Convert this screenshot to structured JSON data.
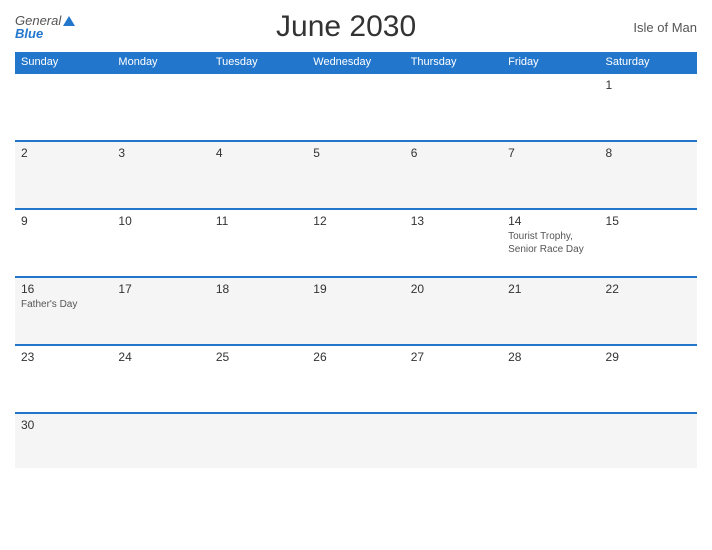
{
  "header": {
    "title": "June 2030",
    "region": "Isle of Man",
    "logo_general": "General",
    "logo_blue": "Blue"
  },
  "weekdays": [
    "Sunday",
    "Monday",
    "Tuesday",
    "Wednesday",
    "Thursday",
    "Friday",
    "Saturday"
  ],
  "weeks": [
    [
      {
        "day": "",
        "event": ""
      },
      {
        "day": "",
        "event": ""
      },
      {
        "day": "",
        "event": ""
      },
      {
        "day": "",
        "event": ""
      },
      {
        "day": "",
        "event": ""
      },
      {
        "day": "",
        "event": ""
      },
      {
        "day": "1",
        "event": ""
      }
    ],
    [
      {
        "day": "2",
        "event": ""
      },
      {
        "day": "3",
        "event": ""
      },
      {
        "day": "4",
        "event": ""
      },
      {
        "day": "5",
        "event": ""
      },
      {
        "day": "6",
        "event": ""
      },
      {
        "day": "7",
        "event": ""
      },
      {
        "day": "8",
        "event": ""
      }
    ],
    [
      {
        "day": "9",
        "event": ""
      },
      {
        "day": "10",
        "event": ""
      },
      {
        "day": "11",
        "event": ""
      },
      {
        "day": "12",
        "event": ""
      },
      {
        "day": "13",
        "event": ""
      },
      {
        "day": "14",
        "event": "Tourist Trophy,\nSenior Race Day"
      },
      {
        "day": "15",
        "event": ""
      }
    ],
    [
      {
        "day": "16",
        "event": "Father's Day"
      },
      {
        "day": "17",
        "event": ""
      },
      {
        "day": "18",
        "event": ""
      },
      {
        "day": "19",
        "event": ""
      },
      {
        "day": "20",
        "event": ""
      },
      {
        "day": "21",
        "event": ""
      },
      {
        "day": "22",
        "event": ""
      }
    ],
    [
      {
        "day": "23",
        "event": ""
      },
      {
        "day": "24",
        "event": ""
      },
      {
        "day": "25",
        "event": ""
      },
      {
        "day": "26",
        "event": ""
      },
      {
        "day": "27",
        "event": ""
      },
      {
        "day": "28",
        "event": ""
      },
      {
        "day": "29",
        "event": ""
      }
    ],
    [
      {
        "day": "30",
        "event": ""
      },
      {
        "day": "",
        "event": ""
      },
      {
        "day": "",
        "event": ""
      },
      {
        "day": "",
        "event": ""
      },
      {
        "day": "",
        "event": ""
      },
      {
        "day": "",
        "event": ""
      },
      {
        "day": "",
        "event": ""
      }
    ]
  ]
}
